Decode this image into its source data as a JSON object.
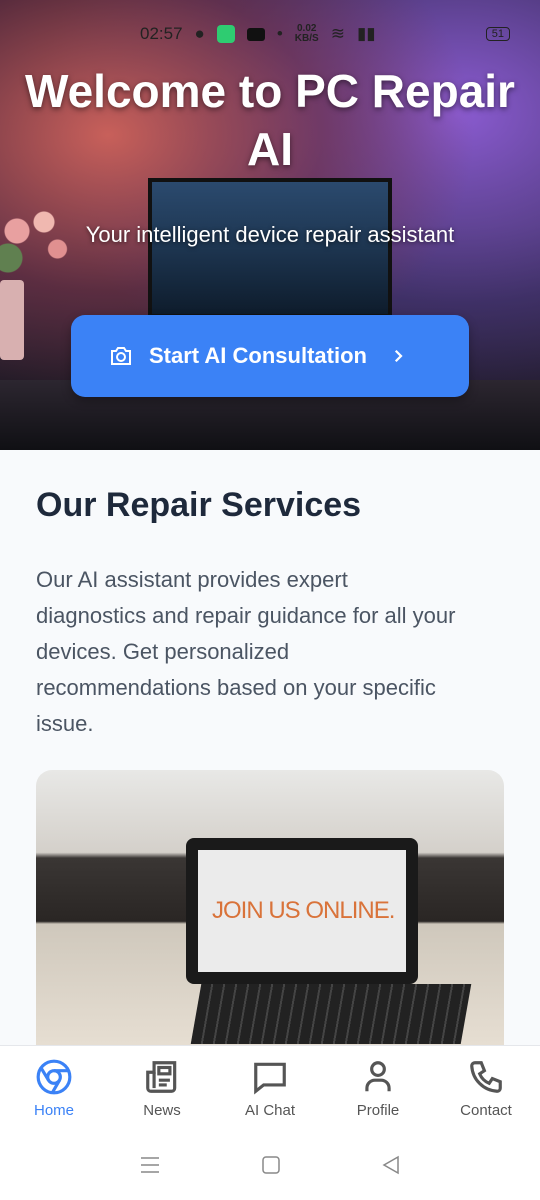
{
  "status_bar": {
    "time": "02:57",
    "net_speed": "0.02",
    "net_unit": "KB/S",
    "battery": "51"
  },
  "hero": {
    "title": "Welcome to PC Repair AI",
    "subtitle": "Your intelligent device repair assistant",
    "cta_label": "Start AI Consultation"
  },
  "services": {
    "heading": "Our Repair Services",
    "description": "Our AI assistant provides expert diagnostics and repair guidance for all your devices. Get personalized recommendations based on your specific issue.",
    "image_screen_text": "JOIN US ONLINE."
  },
  "bottom_nav": {
    "items": [
      {
        "label": "Home",
        "icon": "chrome-icon",
        "active": true
      },
      {
        "label": "News",
        "icon": "newspaper-icon"
      },
      {
        "label": "AI Chat",
        "icon": "chat-icon"
      },
      {
        "label": "Profile",
        "icon": "user-icon"
      },
      {
        "label": "Contact",
        "icon": "phone-icon"
      }
    ]
  },
  "colors": {
    "accent": "#3b82f6",
    "heading": "#1e293b",
    "text": "#4b5563"
  }
}
